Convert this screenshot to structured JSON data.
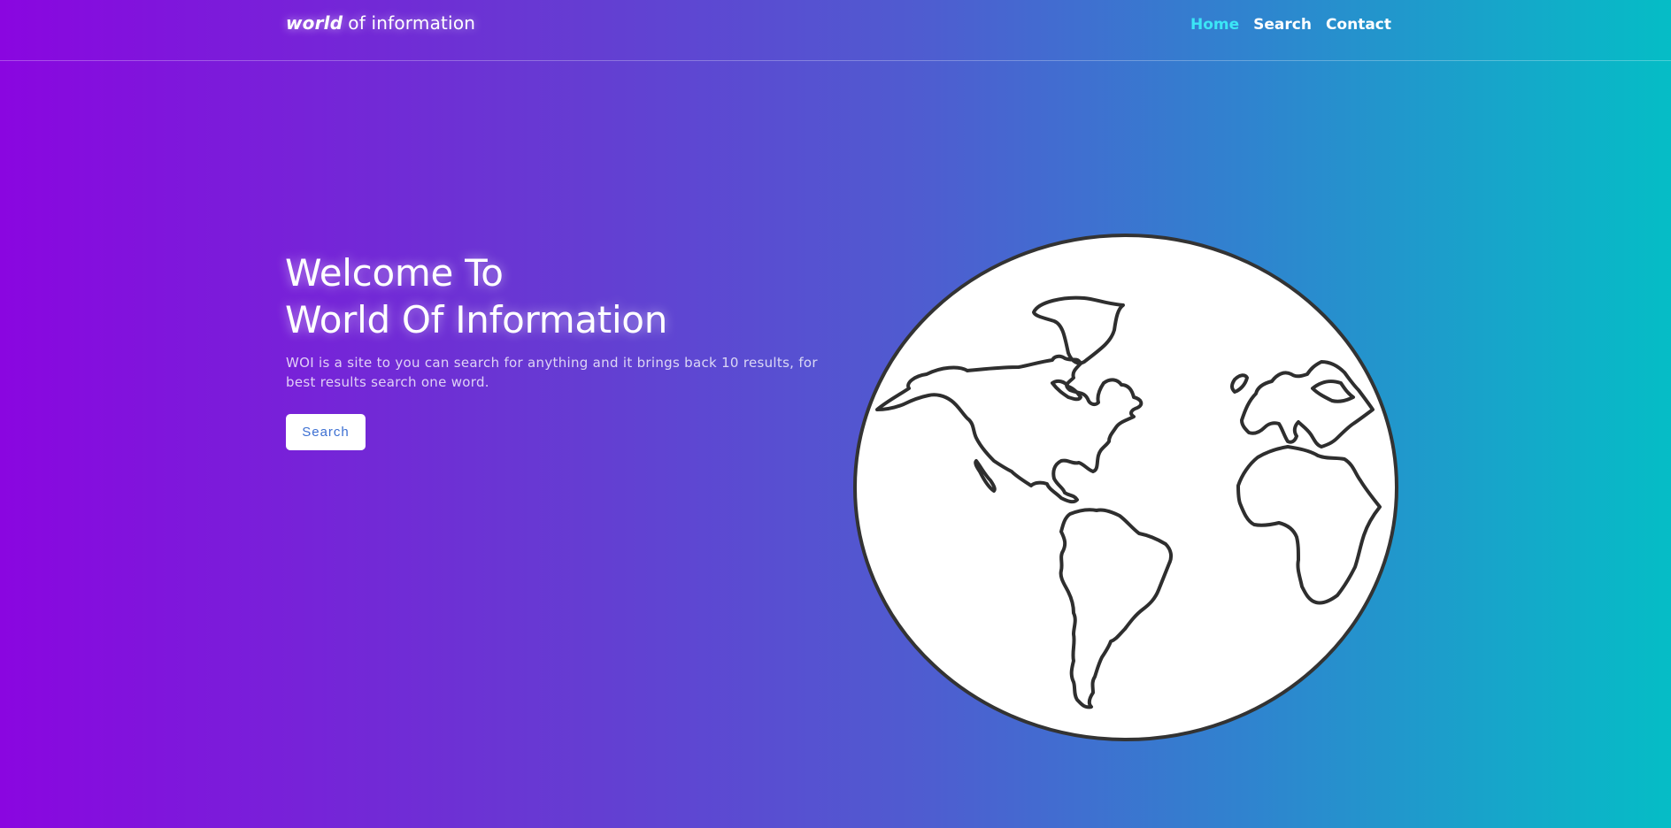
{
  "header": {
    "brand_bold": "world",
    "brand_light": "of information",
    "nav": [
      "Home",
      "Search",
      "Contact"
    ]
  },
  "hero": {
    "title_line1": "Welcome To",
    "title_line2": "World Of Information",
    "description": "WOI is a site to you can search for anything and it brings back 10 results, for best results search one word.",
    "button_label": "Search"
  },
  "illustration": {
    "icon": "globe-icon"
  },
  "colors": {
    "gradient_start": "#8a06e0",
    "gradient_end": "#05bdc6",
    "nav_active": "#3be6f6",
    "button_text": "#3c6fd2"
  }
}
